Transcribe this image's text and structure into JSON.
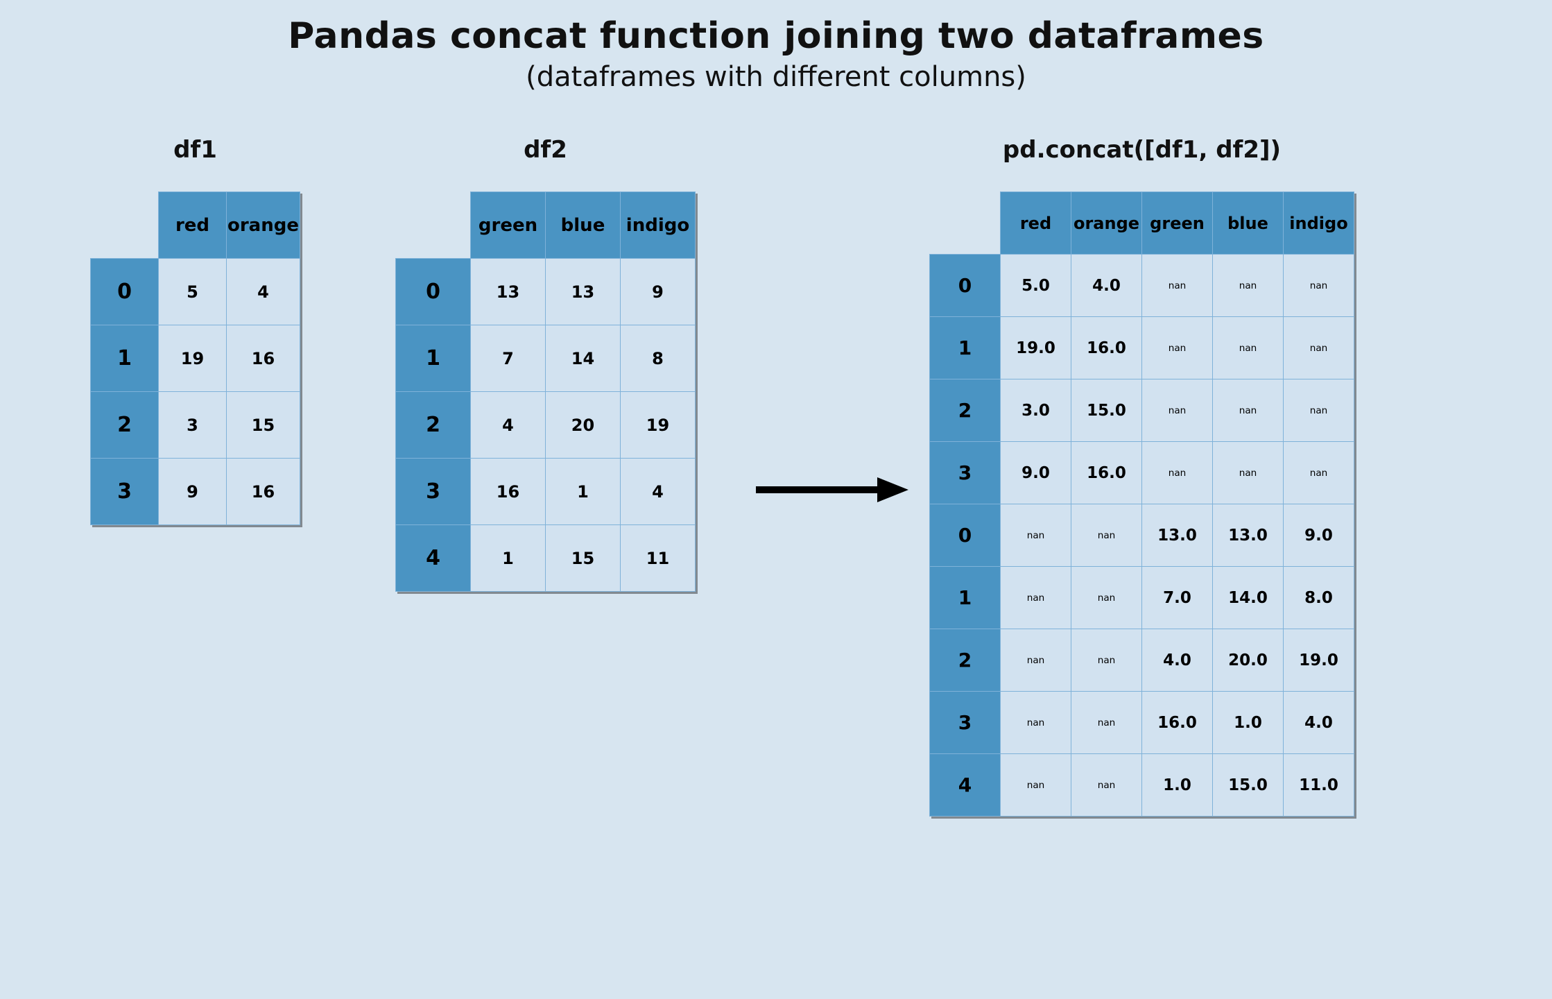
{
  "title": "Pandas concat function joining two dataframes",
  "subtitle": "(dataframes with different columns)",
  "labels": {
    "df1": "df1",
    "df2": "df2",
    "result": "pd.concat([df1, df2])"
  },
  "chart_data": {
    "type": "table",
    "tables": [
      {
        "name": "df1",
        "columns": [
          "red",
          "orange"
        ],
        "index": [
          "0",
          "1",
          "2",
          "3"
        ],
        "data": [
          [
            "5",
            "4"
          ],
          [
            "19",
            "16"
          ],
          [
            "3",
            "15"
          ],
          [
            "9",
            "16"
          ]
        ]
      },
      {
        "name": "df2",
        "columns": [
          "green",
          "blue",
          "indigo"
        ],
        "index": [
          "0",
          "1",
          "2",
          "3",
          "4"
        ],
        "data": [
          [
            "13",
            "13",
            "9"
          ],
          [
            "7",
            "14",
            "8"
          ],
          [
            "4",
            "20",
            "19"
          ],
          [
            "16",
            "1",
            "4"
          ],
          [
            "1",
            "15",
            "11"
          ]
        ]
      },
      {
        "name": "result",
        "columns": [
          "red",
          "orange",
          "green",
          "blue",
          "indigo"
        ],
        "index": [
          "0",
          "1",
          "2",
          "3",
          "0",
          "1",
          "2",
          "3",
          "4"
        ],
        "data": [
          [
            "5.0",
            "4.0",
            "nan",
            "nan",
            "nan"
          ],
          [
            "19.0",
            "16.0",
            "nan",
            "nan",
            "nan"
          ],
          [
            "3.0",
            "15.0",
            "nan",
            "nan",
            "nan"
          ],
          [
            "9.0",
            "16.0",
            "nan",
            "nan",
            "nan"
          ],
          [
            "nan",
            "nan",
            "13.0",
            "13.0",
            "9.0"
          ],
          [
            "nan",
            "nan",
            "7.0",
            "14.0",
            "8.0"
          ],
          [
            "nan",
            "nan",
            "4.0",
            "20.0",
            "19.0"
          ],
          [
            "nan",
            "nan",
            "16.0",
            "1.0",
            "4.0"
          ],
          [
            "nan",
            "nan",
            "1.0",
            "15.0",
            "11.0"
          ]
        ]
      }
    ]
  }
}
